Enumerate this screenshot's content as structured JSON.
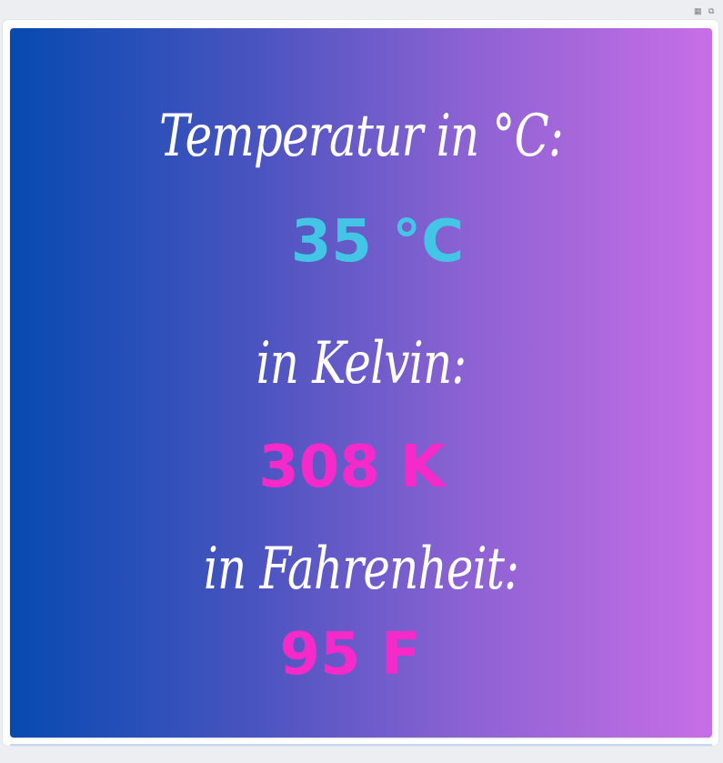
{
  "converter": {
    "celsius_heading": "Temperatur  in °C:",
    "celsius_value": "35 °C",
    "kelvin_heading": "in Kelvin:",
    "kelvin_value": "308 K",
    "fahrenheit_heading": "in Fahrenheit:",
    "fahrenheit_value": "95 F"
  },
  "colors": {
    "gradient_start": "#064ab0",
    "gradient_end": "#c86ee6",
    "celsius_value_color": "#43c6e6",
    "kelvin_value_color": "#f52ac8",
    "fahrenheit_value_color": "#f52ac8",
    "heading_color": "#ffffff"
  },
  "toolbar": {
    "icons": [
      "save-icon",
      "copy-icon"
    ]
  }
}
